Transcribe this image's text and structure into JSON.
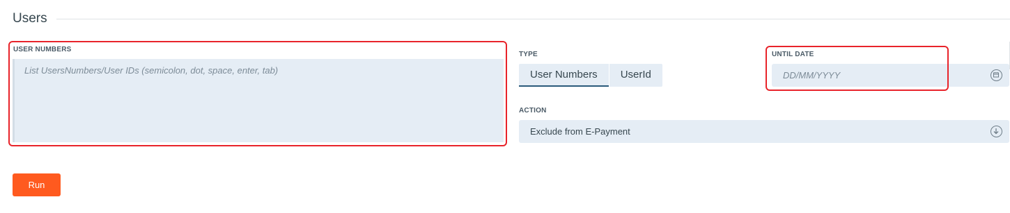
{
  "section": {
    "title": "Users"
  },
  "user_numbers": {
    "label": "USER NUMBERS",
    "placeholder": "List UsersNumbers/User IDs (semicolon, dot, space, enter, tab)",
    "value": ""
  },
  "type": {
    "label": "TYPE",
    "options": [
      {
        "label": "User Numbers",
        "selected": true
      },
      {
        "label": "UserId",
        "selected": false
      }
    ]
  },
  "until_date": {
    "label": "UNTIL DATE",
    "placeholder": "DD/MM/YYYY",
    "value": ""
  },
  "action": {
    "label": "ACTION",
    "selected": "Exclude from E-Payment"
  },
  "run_button": {
    "label": "Run"
  },
  "colors": {
    "accent": "#ff5a1f",
    "field_background": "#e5edf5",
    "highlight": "#e8232a",
    "active_underline": "#2a5a7a"
  },
  "icons": {
    "date_picker": "calendar-icon",
    "select_dropdown": "chevron-down-circle-icon"
  }
}
